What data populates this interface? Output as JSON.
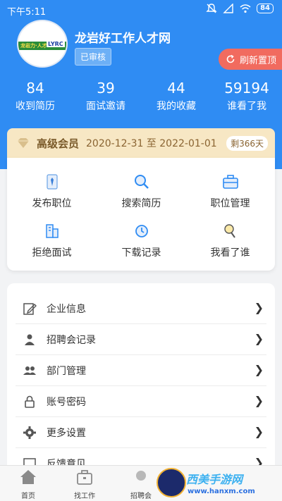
{
  "status_bar": {
    "time": "下午5:11",
    "battery": "84"
  },
  "profile": {
    "logo_text_left": "龙岩力·人才",
    "logo_text_right": "LYRC",
    "company_name": "龙岩好工作人才网",
    "audit_status": "已审核",
    "refresh_button": "刷新置顶"
  },
  "stats": [
    {
      "value": "84",
      "label": "收到简历"
    },
    {
      "value": "39",
      "label": "面试邀请"
    },
    {
      "value": "44",
      "label": "我的收藏"
    },
    {
      "value": "59194",
      "label": "谁看了我"
    }
  ],
  "membership": {
    "title": "高级会员",
    "period": "2020-12-31 至 2022-01-01",
    "remaining": "剩366天"
  },
  "quick_actions": [
    {
      "label": "发布职位",
      "icon": "post-job-icon"
    },
    {
      "label": "搜索简历",
      "icon": "search-icon"
    },
    {
      "label": "职位管理",
      "icon": "briefcase-icon"
    },
    {
      "label": "拒绝面试",
      "icon": "building-icon"
    },
    {
      "label": "下载记录",
      "icon": "clock-icon"
    },
    {
      "label": "我看了谁",
      "icon": "lamp-icon"
    }
  ],
  "menu": [
    {
      "label": "企业信息",
      "icon": "edit-icon"
    },
    {
      "label": "招聘会记录",
      "icon": "users-icon"
    },
    {
      "label": "部门管理",
      "icon": "people-icon"
    },
    {
      "label": "账号密码",
      "icon": "lock-icon"
    },
    {
      "label": "更多设置",
      "icon": "gear-icon"
    },
    {
      "label": "反馈意见",
      "icon": "feedback-icon"
    }
  ],
  "tabbar": [
    {
      "label": "首页",
      "icon": "home-icon"
    },
    {
      "label": "找工作",
      "icon": "briefcase-icon"
    },
    {
      "label": "招聘会",
      "icon": "fair-icon"
    }
  ],
  "watermark": {
    "text": "西美手游网",
    "url": "www.hanxm.com"
  },
  "colors": {
    "primary": "#2f8cf3",
    "refresh": "#f16b5f",
    "vip_bg": "#f7e7c4"
  }
}
